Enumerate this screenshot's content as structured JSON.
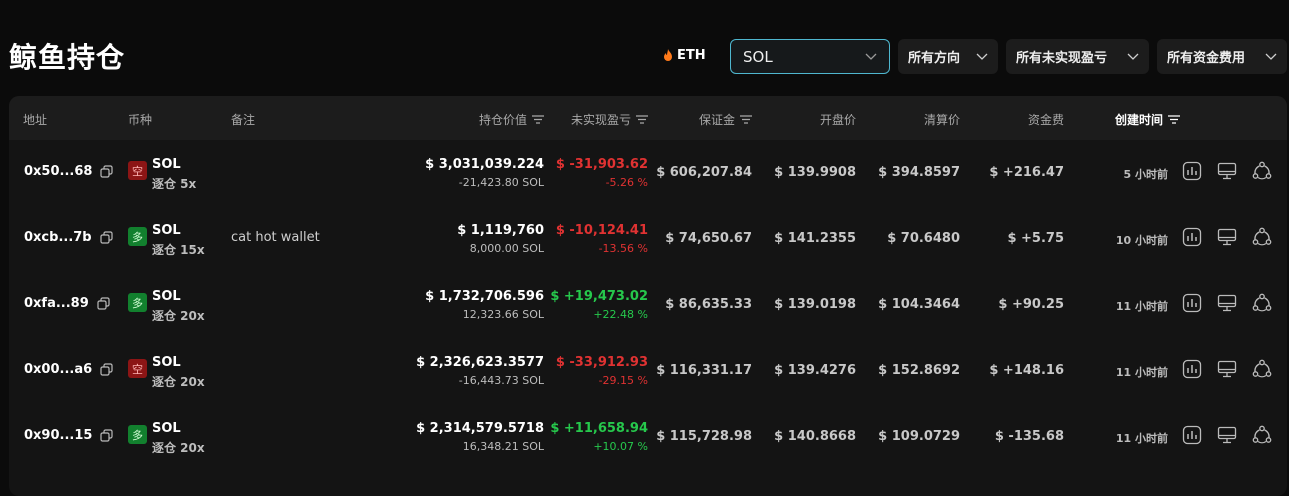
{
  "page_title": "鲸鱼持仓",
  "filters": {
    "eth_label": "ETH",
    "coin_selected": "SOL",
    "direction": "所有方向",
    "unrealized_pnl": "所有未实现盈亏",
    "funding": "所有资金费用"
  },
  "columns": {
    "address": "地址",
    "coin": "币种",
    "note": "备注",
    "position_value": "持仓价值",
    "unrealized_pnl": "未实现盈亏",
    "margin": "保证金",
    "open_price": "开盘价",
    "liq_price": "清算价",
    "funding": "资金费",
    "created": "创建时间"
  },
  "colors": {
    "accent": "#4fb7cf",
    "short": "#8c1515",
    "long": "#12802e",
    "negative": "#e03232",
    "positive": "#26c84c"
  },
  "rows": [
    {
      "address": "0x50...68",
      "side": "空",
      "side_type": "short",
      "coin": "SOL",
      "leverage": "逐仓 5x",
      "note": "",
      "value": "$ 3,031,039.224",
      "size": "-21,423.80 SOL",
      "pnl": "$ -31,903.62",
      "pnl_pct": "-5.26 %",
      "pnl_sign": "neg",
      "margin": "$ 606,207.84",
      "open": "$ 139.9908",
      "liq": "$ 394.8597",
      "funding": "$ +216.47",
      "funding_sign": "pos",
      "time": "5 小时前"
    },
    {
      "address": "0xcb...7b",
      "side": "多",
      "side_type": "long",
      "coin": "SOL",
      "leverage": "逐仓 15x",
      "note": "cat hot wallet",
      "value": "$ 1,119,760",
      "size": "8,000.00 SOL",
      "pnl": "$ -10,124.41",
      "pnl_pct": "-13.56 %",
      "pnl_sign": "neg",
      "margin": "$ 74,650.67",
      "open": "$ 141.2355",
      "liq": "$ 70.6480",
      "funding": "$ +5.75",
      "funding_sign": "pos",
      "time": "10 小时前"
    },
    {
      "address": "0xfa...89",
      "side": "多",
      "side_type": "long",
      "coin": "SOL",
      "leverage": "逐仓 20x",
      "note": "",
      "value": "$ 1,732,706.596",
      "size": "12,323.66 SOL",
      "pnl": "$ +19,473.02",
      "pnl_pct": "+22.48 %",
      "pnl_sign": "pos",
      "margin": "$ 86,635.33",
      "open": "$ 139.0198",
      "liq": "$ 104.3464",
      "funding": "$ +90.25",
      "funding_sign": "pos",
      "time": "11 小时前"
    },
    {
      "address": "0x00...a6",
      "side": "空",
      "side_type": "short",
      "coin": "SOL",
      "leverage": "逐仓 20x",
      "note": "",
      "value": "$ 2,326,623.3577",
      "size": "-16,443.73 SOL",
      "pnl": "$ -33,912.93",
      "pnl_pct": "-29.15 %",
      "pnl_sign": "neg",
      "margin": "$ 116,331.17",
      "open": "$ 139.4276",
      "liq": "$ 152.8692",
      "funding": "$ +148.16",
      "funding_sign": "pos",
      "time": "11 小时前"
    },
    {
      "address": "0x90...15",
      "side": "多",
      "side_type": "long",
      "coin": "SOL",
      "leverage": "逐仓 20x",
      "note": "",
      "value": "$ 2,314,579.5718",
      "size": "16,348.21 SOL",
      "pnl": "$ +11,658.94",
      "pnl_pct": "+10.07 %",
      "pnl_sign": "pos",
      "margin": "$ 115,728.98",
      "open": "$ 140.8668",
      "liq": "$ 109.0729",
      "funding": "$ -135.68",
      "funding_sign": "neg",
      "time": "11 小时前"
    }
  ]
}
